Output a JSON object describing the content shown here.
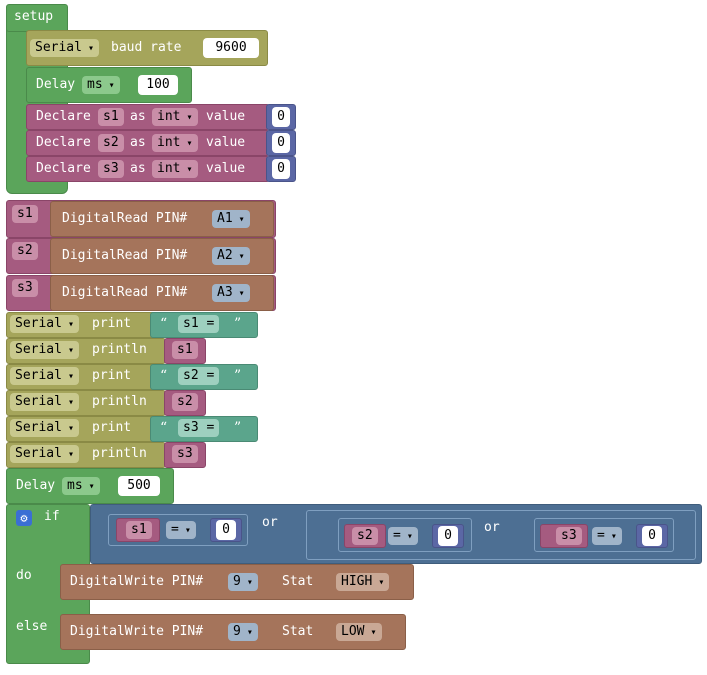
{
  "setup": {
    "label": "setup",
    "serial": {
      "dropdown": "Serial",
      "text": "baud rate",
      "value": "9600"
    },
    "delay": {
      "label": "Delay",
      "unit": "ms",
      "value": "100"
    },
    "declares": [
      {
        "label": "Declare",
        "var": "s1",
        "as": "as",
        "type": "int",
        "value_label": "value",
        "value": "0"
      },
      {
        "label": "Declare",
        "var": "s2",
        "as": "as",
        "type": "int",
        "value_label": "value",
        "value": "0"
      },
      {
        "label": "Declare",
        "var": "s3",
        "as": "as",
        "type": "int",
        "value_label": "value",
        "value": "0"
      }
    ]
  },
  "reads": [
    {
      "var": "s1",
      "label": "DigitalRead PIN#",
      "pin": "A1"
    },
    {
      "var": "s2",
      "label": "DigitalRead PIN#",
      "pin": "A2"
    },
    {
      "var": "s3",
      "label": "DigitalRead PIN#",
      "pin": "A3"
    }
  ],
  "prints": [
    {
      "dropdown": "Serial",
      "method": "print",
      "kind": "text",
      "value": "s1 = "
    },
    {
      "dropdown": "Serial",
      "method": "println",
      "kind": "var",
      "value": "s1"
    },
    {
      "dropdown": "Serial",
      "method": "print",
      "kind": "text",
      "value": "s2 = "
    },
    {
      "dropdown": "Serial",
      "method": "println",
      "kind": "var",
      "value": "s2"
    },
    {
      "dropdown": "Serial",
      "method": "print",
      "kind": "text",
      "value": "s3 = "
    },
    {
      "dropdown": "Serial",
      "method": "println",
      "kind": "var",
      "value": "s3"
    }
  ],
  "delay2": {
    "label": "Delay",
    "unit": "ms",
    "value": "500"
  },
  "ifblock": {
    "if_label": "if",
    "do_label": "do",
    "else_label": "else",
    "cond": {
      "c1": {
        "var": "s1",
        "op": "=",
        "value": "0"
      },
      "or1": "or",
      "c2": {
        "var": "s2",
        "op": "=",
        "value": "0"
      },
      "or2": "or",
      "c3": {
        "var": "s3",
        "op": "=",
        "value": "0"
      }
    },
    "do_stmt": {
      "label": "DigitalWrite PIN#",
      "pin": "9",
      "stat_label": "Stat",
      "stat": "HIGH"
    },
    "else_stmt": {
      "label": "DigitalWrite PIN#",
      "pin": "9",
      "stat_label": "Stat",
      "stat": "LOW"
    }
  },
  "quote_open": "“",
  "quote_close": "”",
  "icons": {
    "gear": "gear-icon"
  }
}
